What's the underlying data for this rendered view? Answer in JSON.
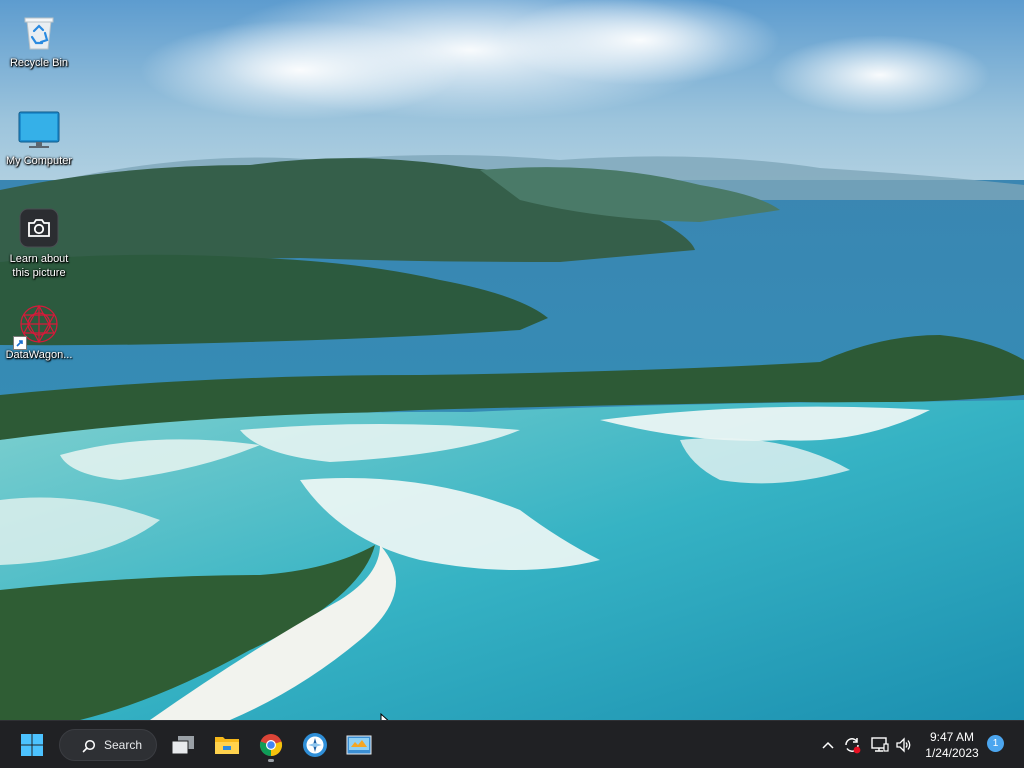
{
  "desktop": {
    "icons": [
      {
        "label": "Recycle Bin",
        "icon": "recycle-bin-icon"
      },
      {
        "label": "My Computer",
        "icon": "monitor-icon"
      },
      {
        "label": "Learn about this picture",
        "icon": "camera-icon"
      },
      {
        "label": "DataWagon...",
        "icon": "datawagon-icon"
      }
    ]
  },
  "taskbar": {
    "search_label": "Search",
    "apps": [
      {
        "name": "Task View",
        "icon": "task-view-icon"
      },
      {
        "name": "File Explorer",
        "icon": "folder-icon"
      },
      {
        "name": "Google Chrome",
        "icon": "chrome-icon",
        "active": true
      },
      {
        "name": "Application",
        "icon": "compass-app-icon"
      },
      {
        "name": "Control Panel",
        "icon": "control-panel-icon"
      }
    ],
    "tray": {
      "time": "9:47 AM",
      "date": "1/24/2023",
      "notification_count": "1"
    }
  },
  "colors": {
    "taskbar_bg": "#202124",
    "accent": "#4ca6ef"
  }
}
